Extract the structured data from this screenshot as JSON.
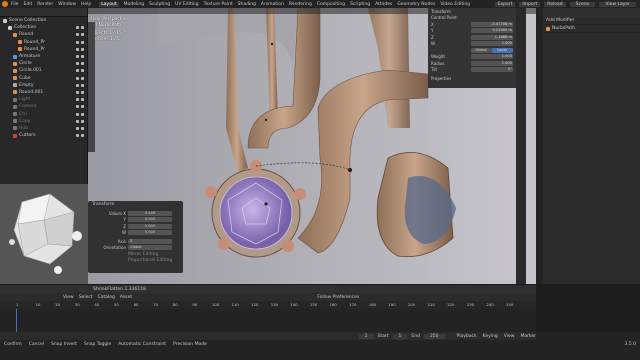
{
  "topbar": {
    "menu": [
      "File",
      "Edit",
      "Render",
      "Window",
      "Help"
    ],
    "workspaces": [
      "Layout",
      "Modeling",
      "Sculpting",
      "UV Editing",
      "Texture Paint",
      "Shading",
      "Animation",
      "Rendering",
      "Compositing",
      "Scripting",
      "Attodes",
      "Geometry Nodes",
      "Video Editing"
    ],
    "active_workspace": "Layout",
    "right": [
      "Export",
      "Import",
      "Reload"
    ],
    "scene": "Scene",
    "view_layer": "View Layer"
  },
  "outliner": {
    "rows": [
      {
        "label": "Scene Collection",
        "color": "#cccccc"
      },
      {
        "label": "Collection",
        "color": "#cccccc"
      },
      {
        "label": "Round",
        "color": "#e09050"
      },
      {
        "label": "Round_Pr",
        "color": "#e09050"
      },
      {
        "label": "Round_Pr",
        "color": "#e09050"
      },
      {
        "label": "Armature",
        "color": "#5a9bd6"
      },
      {
        "label": "Circle",
        "color": "#e09050"
      },
      {
        "label": "Circle.001",
        "color": "#e09050"
      },
      {
        "label": "Cube",
        "color": "#e09050"
      },
      {
        "label": "Empty",
        "color": "#aaaaaa"
      },
      {
        "label": "Round.001",
        "color": "#e09050"
      },
      {
        "label": "Light",
        "color": "#777777"
      },
      {
        "label": "Camera",
        "color": "#777777"
      },
      {
        "label": "Ctrl",
        "color": "#777777"
      },
      {
        "label": "Copy",
        "color": "#777777"
      },
      {
        "label": "Hub",
        "color": "#777777"
      },
      {
        "label": "Cutters",
        "color": "#d04040"
      }
    ]
  },
  "viewport": {
    "mode_label": "User Perspective",
    "object_label": "(1) NurbsPath",
    "objects": "Objects",
    "objects_val": "1 / 15",
    "vertices": "Vertices",
    "vertices_val": "1 / 5"
  },
  "npanel": {
    "title": "Transform",
    "section": "Control Point:",
    "rows": [
      {
        "label": "X",
        "value": "-0.47708 m"
      },
      {
        "label": "Y",
        "value": "0.21905 m"
      },
      {
        "label": "Z",
        "value": "1.1688 m"
      },
      {
        "label": "W",
        "value": "1.000"
      }
    ],
    "global_local": [
      "Global",
      "Local"
    ],
    "weight": {
      "label": "Weight",
      "value": "1.000"
    },
    "radius": {
      "label": "Radius",
      "value": "1.000"
    },
    "tilt": {
      "label": "Tilt",
      "value": "0°"
    },
    "properties": "Properties"
  },
  "transform_panel": {
    "title": "Transform",
    "rows": [
      {
        "label": "Values X",
        "value": "0.446"
      },
      {
        "label": "Y",
        "value": "0.000"
      },
      {
        "label": "Z",
        "value": "0.000"
      },
      {
        "label": "W",
        "value": "0.000"
      }
    ],
    "axis_label": "Axis",
    "axis_value": "Z",
    "orientation_label": "Orientation",
    "orientation_value": "Global",
    "mirror": "Mirror Editing",
    "proportional": "Proportional Editing"
  },
  "props": {
    "add_modifier": "Add Modifier",
    "object_name": "NurbsPath"
  },
  "preview": {
    "mode": "Edit Mode",
    "menus": [
      "View",
      "Select"
    ]
  },
  "timeline": {
    "file": "ShrinkFlatten.1.336118",
    "menus": [
      "View",
      "Select",
      "Catalog",
      "Asset"
    ],
    "follow": "Follow Preferences",
    "ticks": [
      "1",
      "10",
      "20",
      "30",
      "40",
      "50",
      "60",
      "70",
      "80",
      "90",
      "100",
      "110",
      "120",
      "130",
      "140",
      "150",
      "160",
      "170",
      "180",
      "190",
      "200",
      "210",
      "220",
      "230",
      "240",
      "250"
    ],
    "current_frame": "1",
    "start_label": "Start",
    "start": "1",
    "end_label": "End",
    "end": "250"
  },
  "playback": [
    "Playback",
    "Keying",
    "View",
    "Marker"
  ],
  "status": [
    "Confirm",
    "Cancel",
    "Snap Invert",
    "Snap Toggle",
    "Automatic Constraint",
    "Precision Mode"
  ],
  "version": "3.5.0",
  "colors": {
    "accent": "#4772b3",
    "brand": "#e87d0d"
  }
}
